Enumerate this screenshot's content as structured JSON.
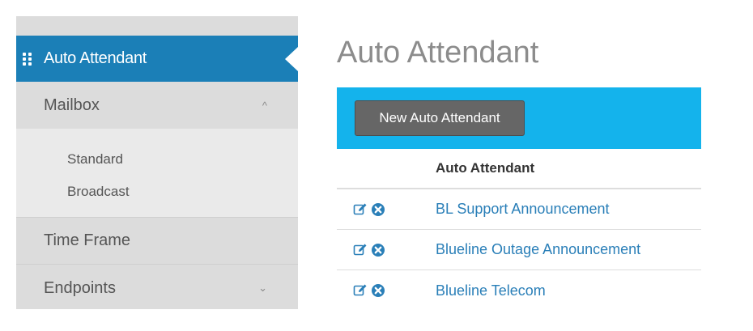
{
  "sidebar": {
    "active": {
      "label": "Auto Attendant",
      "icon": "grip-dots-icon"
    },
    "items": [
      {
        "label": "Mailbox",
        "chevron": "^",
        "expanded": true,
        "children": [
          {
            "label": "Standard"
          },
          {
            "label": "Broadcast"
          }
        ]
      },
      {
        "label": "Time Frame"
      },
      {
        "label": "Endpoints",
        "chevron": "⌄",
        "expanded": false
      }
    ]
  },
  "main": {
    "title": "Auto Attendant",
    "toolbar": {
      "new_button_label": "New Auto Attendant"
    },
    "table": {
      "column_header": "Auto Attendant",
      "rows": [
        {
          "name": "BL Support Announcement"
        },
        {
          "name": "Blueline Outage Announcement"
        },
        {
          "name": "Blueline Telecom"
        }
      ]
    }
  },
  "colors": {
    "sidebar_active": "#1b7fb7",
    "toolbar": "#14b3ec",
    "link": "#2a7fb8",
    "button": "#666666"
  }
}
